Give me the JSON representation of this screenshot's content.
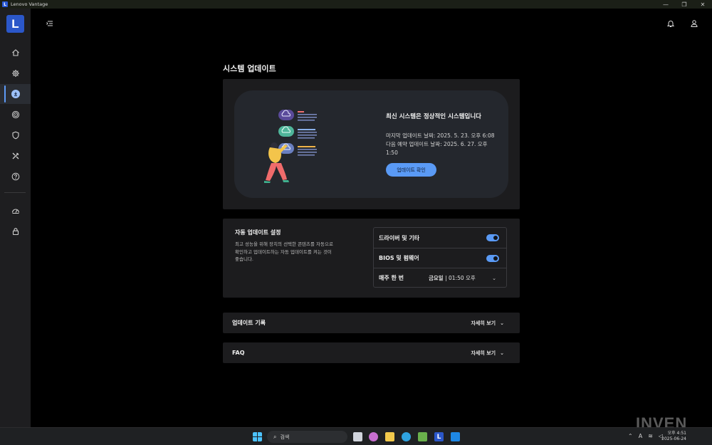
{
  "window": {
    "title": "Lenovo Vantage",
    "controls": [
      "—",
      "❐",
      "✕"
    ]
  },
  "brand": {
    "logo_letter": "L",
    "accent": "#5a9af5"
  },
  "sidebar": {
    "items": [
      {
        "icon": "home-icon"
      },
      {
        "icon": "gear-icon"
      },
      {
        "icon": "download-icon",
        "active": true
      },
      {
        "icon": "target-icon"
      },
      {
        "icon": "shield-icon"
      },
      {
        "icon": "tools-icon"
      },
      {
        "icon": "help-icon"
      },
      {
        "icon": "speedometer-icon"
      },
      {
        "icon": "lock-icon"
      }
    ]
  },
  "page": {
    "title": "시스템 업데이트"
  },
  "status": {
    "heading": "최신 시스템은 정상적인 시스템입니다",
    "last_update": "마지막 업데이트 날짜: 2025. 5. 23. 오후 6:08",
    "next_update_1": "다음 예약 업데이트 날짜: 2025. 6. 27. 오후",
    "next_update_2": "1:50",
    "check_button": "업데이트 확인"
  },
  "auto_update": {
    "title": "자동 업데이트 설정",
    "description": "최고 성능을 위해 장치의 선택한 콘텐츠를 자동으로 확인하고 업데이트하는 자동 업데이트를 켜는 것이 좋습니다.",
    "options": [
      {
        "label": "드라이버 및 기타",
        "enabled": true
      },
      {
        "label": "BIOS 및 펌웨어",
        "enabled": true
      }
    ],
    "schedule": {
      "label": "매주 한 번",
      "day": "금요일",
      "time": "01:50 오후"
    }
  },
  "sections": [
    {
      "label": "업데이트 기록",
      "more": "자세히 보기"
    },
    {
      "label": "FAQ",
      "more": "자세히 보기"
    }
  ],
  "taskbar": {
    "search_placeholder": "검색",
    "time": "오후 4:51",
    "date": "2025-06-24"
  },
  "watermark": "INVEN"
}
